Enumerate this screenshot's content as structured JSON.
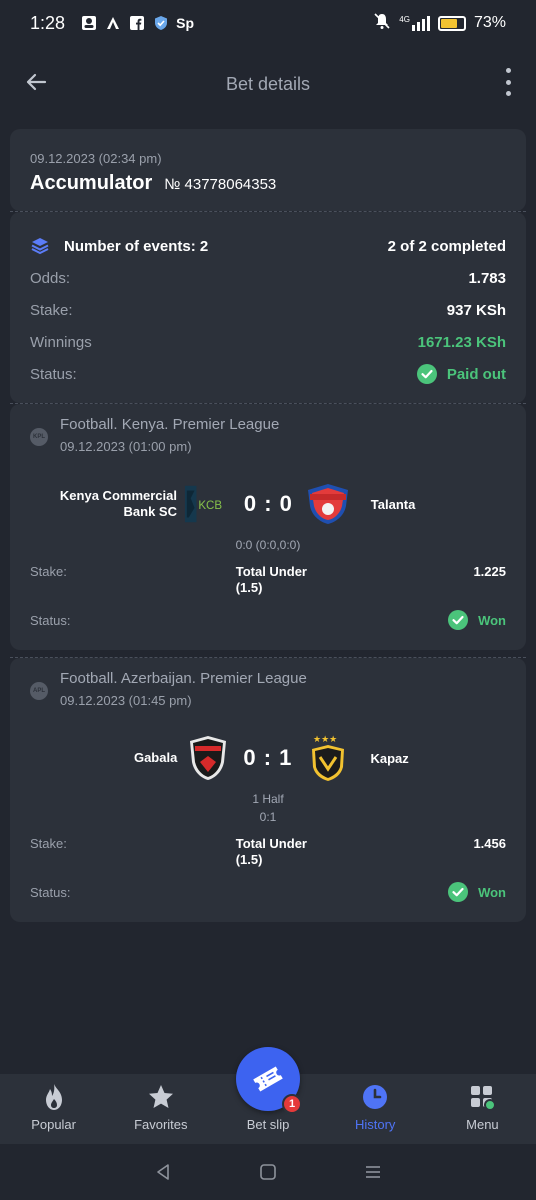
{
  "status_bar": {
    "time": "1:28",
    "signal_label": "4G",
    "battery": "73%"
  },
  "header": {
    "title": "Bet details"
  },
  "bet": {
    "date": "09.12.2023 (02:34 pm)",
    "type": "Accumulator",
    "number": "№ 43778064353",
    "events_label": "Number of events: 2",
    "completed": "2 of 2 completed",
    "odds_label": "Odds:",
    "odds": "1.783",
    "stake_label": "Stake:",
    "stake": "937 KSh",
    "winnings_label": "Winnings",
    "winnings": "1671.23 KSh",
    "status_label": "Status:",
    "status": "Paid out"
  },
  "events": [
    {
      "league": "Football. Kenya. Premier League",
      "date": "09.12.2023 (01:00 pm)",
      "home": "Kenya Commercial Bank SC",
      "home_logo_text": "KCB",
      "away": "Talanta",
      "score": "0 : 0",
      "sub1": "0:0 (0:0,0:0)",
      "sub2": "",
      "stake_label": "Stake:",
      "pick": "Total Under (1.5)",
      "odds": "1.225",
      "status_label": "Status:",
      "status": "Won"
    },
    {
      "league": "Football. Azerbaijan. Premier League",
      "date": "09.12.2023 (01:45 pm)",
      "home": "Gabala",
      "away": "Kapaz",
      "score": "0 : 1",
      "sub1": "1 Half",
      "sub2": "0:1",
      "stake_label": "Stake:",
      "pick": "Total Under (1.5)",
      "odds": "1.456",
      "status_label": "Status:",
      "status": "Won"
    }
  ],
  "nav": {
    "popular": "Popular",
    "favorites": "Favorites",
    "betslip": "Bet slip",
    "betslip_badge": "1",
    "history": "History",
    "menu": "Menu"
  },
  "colors": {
    "accent": "#3d63f0",
    "success": "#4bc47b",
    "card": "#2c313a",
    "bg": "#22262f"
  }
}
